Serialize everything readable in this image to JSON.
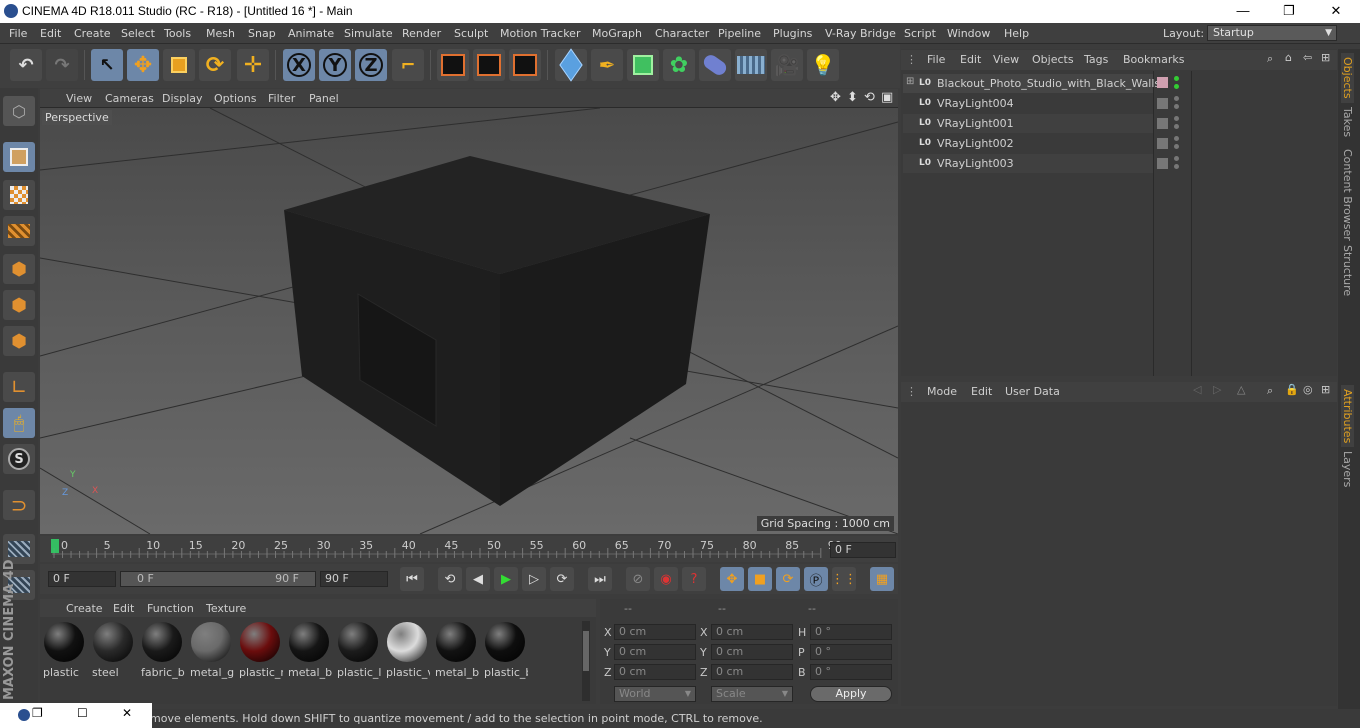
{
  "window": {
    "title": "CINEMA 4D R18.011 Studio (RC - R18) - [Untitled 16 *] - Main",
    "minimize": "—",
    "restore": "❐",
    "close": "✕"
  },
  "menubar": {
    "items": [
      "File",
      "Edit",
      "Create",
      "Select",
      "Tools",
      "Mesh",
      "Snap",
      "Animate",
      "Simulate",
      "Render",
      "Sculpt",
      "Motion Tracker",
      "MoGraph",
      "Character",
      "Pipeline",
      "Plugins",
      "V-Ray Bridge",
      "Script",
      "Window",
      "Help"
    ],
    "layout_label": "Layout:",
    "layout_value": "Startup"
  },
  "toolbar": {
    "x_axis": "X",
    "y_axis": "Y",
    "z_axis": "Z"
  },
  "viewport": {
    "menu": [
      "View",
      "Cameras",
      "Display",
      "Options",
      "Filter",
      "Panel"
    ],
    "camera_label": "Perspective",
    "grid_spacing": "Grid Spacing : 1000 cm",
    "axis_x": "X",
    "axis_y": "Y",
    "axis_z": "Z"
  },
  "timeline": {
    "ticks": [
      "0",
      "5",
      "10",
      "15",
      "20",
      "25",
      "30",
      "35",
      "40",
      "45",
      "50",
      "55",
      "60",
      "65",
      "70",
      "75",
      "80",
      "85",
      "90"
    ],
    "current_frame": "0 F",
    "start_field": "0 F",
    "slider_start": "0 F",
    "slider_end": "90 F",
    "end_field": "90 F"
  },
  "materials": {
    "menu": [
      "Create",
      "Edit",
      "Function",
      "Texture"
    ],
    "items": [
      {
        "label": "plastic",
        "color": "#111111"
      },
      {
        "label": "steel",
        "color": "#2a2a2a"
      },
      {
        "label": "fabric_b",
        "color": "#1a1a1a"
      },
      {
        "label": "metal_g",
        "color": "#6a6a6a"
      },
      {
        "label": "plastic_r",
        "color": "#6b0d0d"
      },
      {
        "label": "metal_b",
        "color": "#151515"
      },
      {
        "label": "plastic_l",
        "color": "#1c1c1c"
      },
      {
        "label": "plastic_v",
        "color": "#dcdcdc"
      },
      {
        "label": "metal_b",
        "color": "#121212"
      },
      {
        "label": "plastic_b",
        "color": "#0e0e0e"
      }
    ]
  },
  "coordinates": {
    "headers": [
      "--",
      "--",
      "--"
    ],
    "rows": [
      {
        "l1": "X",
        "v1": "0 cm",
        "l2": "X",
        "v2": "0 cm",
        "l3": "H",
        "v3": "0 °"
      },
      {
        "l1": "Y",
        "v1": "0 cm",
        "l2": "Y",
        "v2": "0 cm",
        "l3": "P",
        "v3": "0 °"
      },
      {
        "l1": "Z",
        "v1": "0 cm",
        "l2": "Z",
        "v2": "0 cm",
        "l3": "B",
        "v3": "0 °"
      }
    ],
    "mode_select": "World",
    "scale_select": "Scale",
    "apply_label": "Apply"
  },
  "objects": {
    "menu": [
      "File",
      "Edit",
      "View",
      "Objects",
      "Tags",
      "Bookmarks"
    ],
    "items": [
      {
        "name": "Blackout_Photo_Studio_with_Black_Walls"
      },
      {
        "name": "VRayLight004"
      },
      {
        "name": "VRayLight001"
      },
      {
        "name": "VRayLight002"
      },
      {
        "name": "VRayLight003"
      }
    ]
  },
  "attributes": {
    "menu": [
      "Mode",
      "Edit",
      "User Data"
    ]
  },
  "right_tabs": [
    "Objects",
    "Takes",
    "Content Browser",
    "Structure",
    "Attributes",
    "Layers"
  ],
  "status": {
    "text": "move elements. Hold down SHIFT to quantize movement / add to the selection in point mode, CTRL to remove."
  },
  "brand": {
    "vertical_logo": "MAXON CINEMA 4D"
  }
}
